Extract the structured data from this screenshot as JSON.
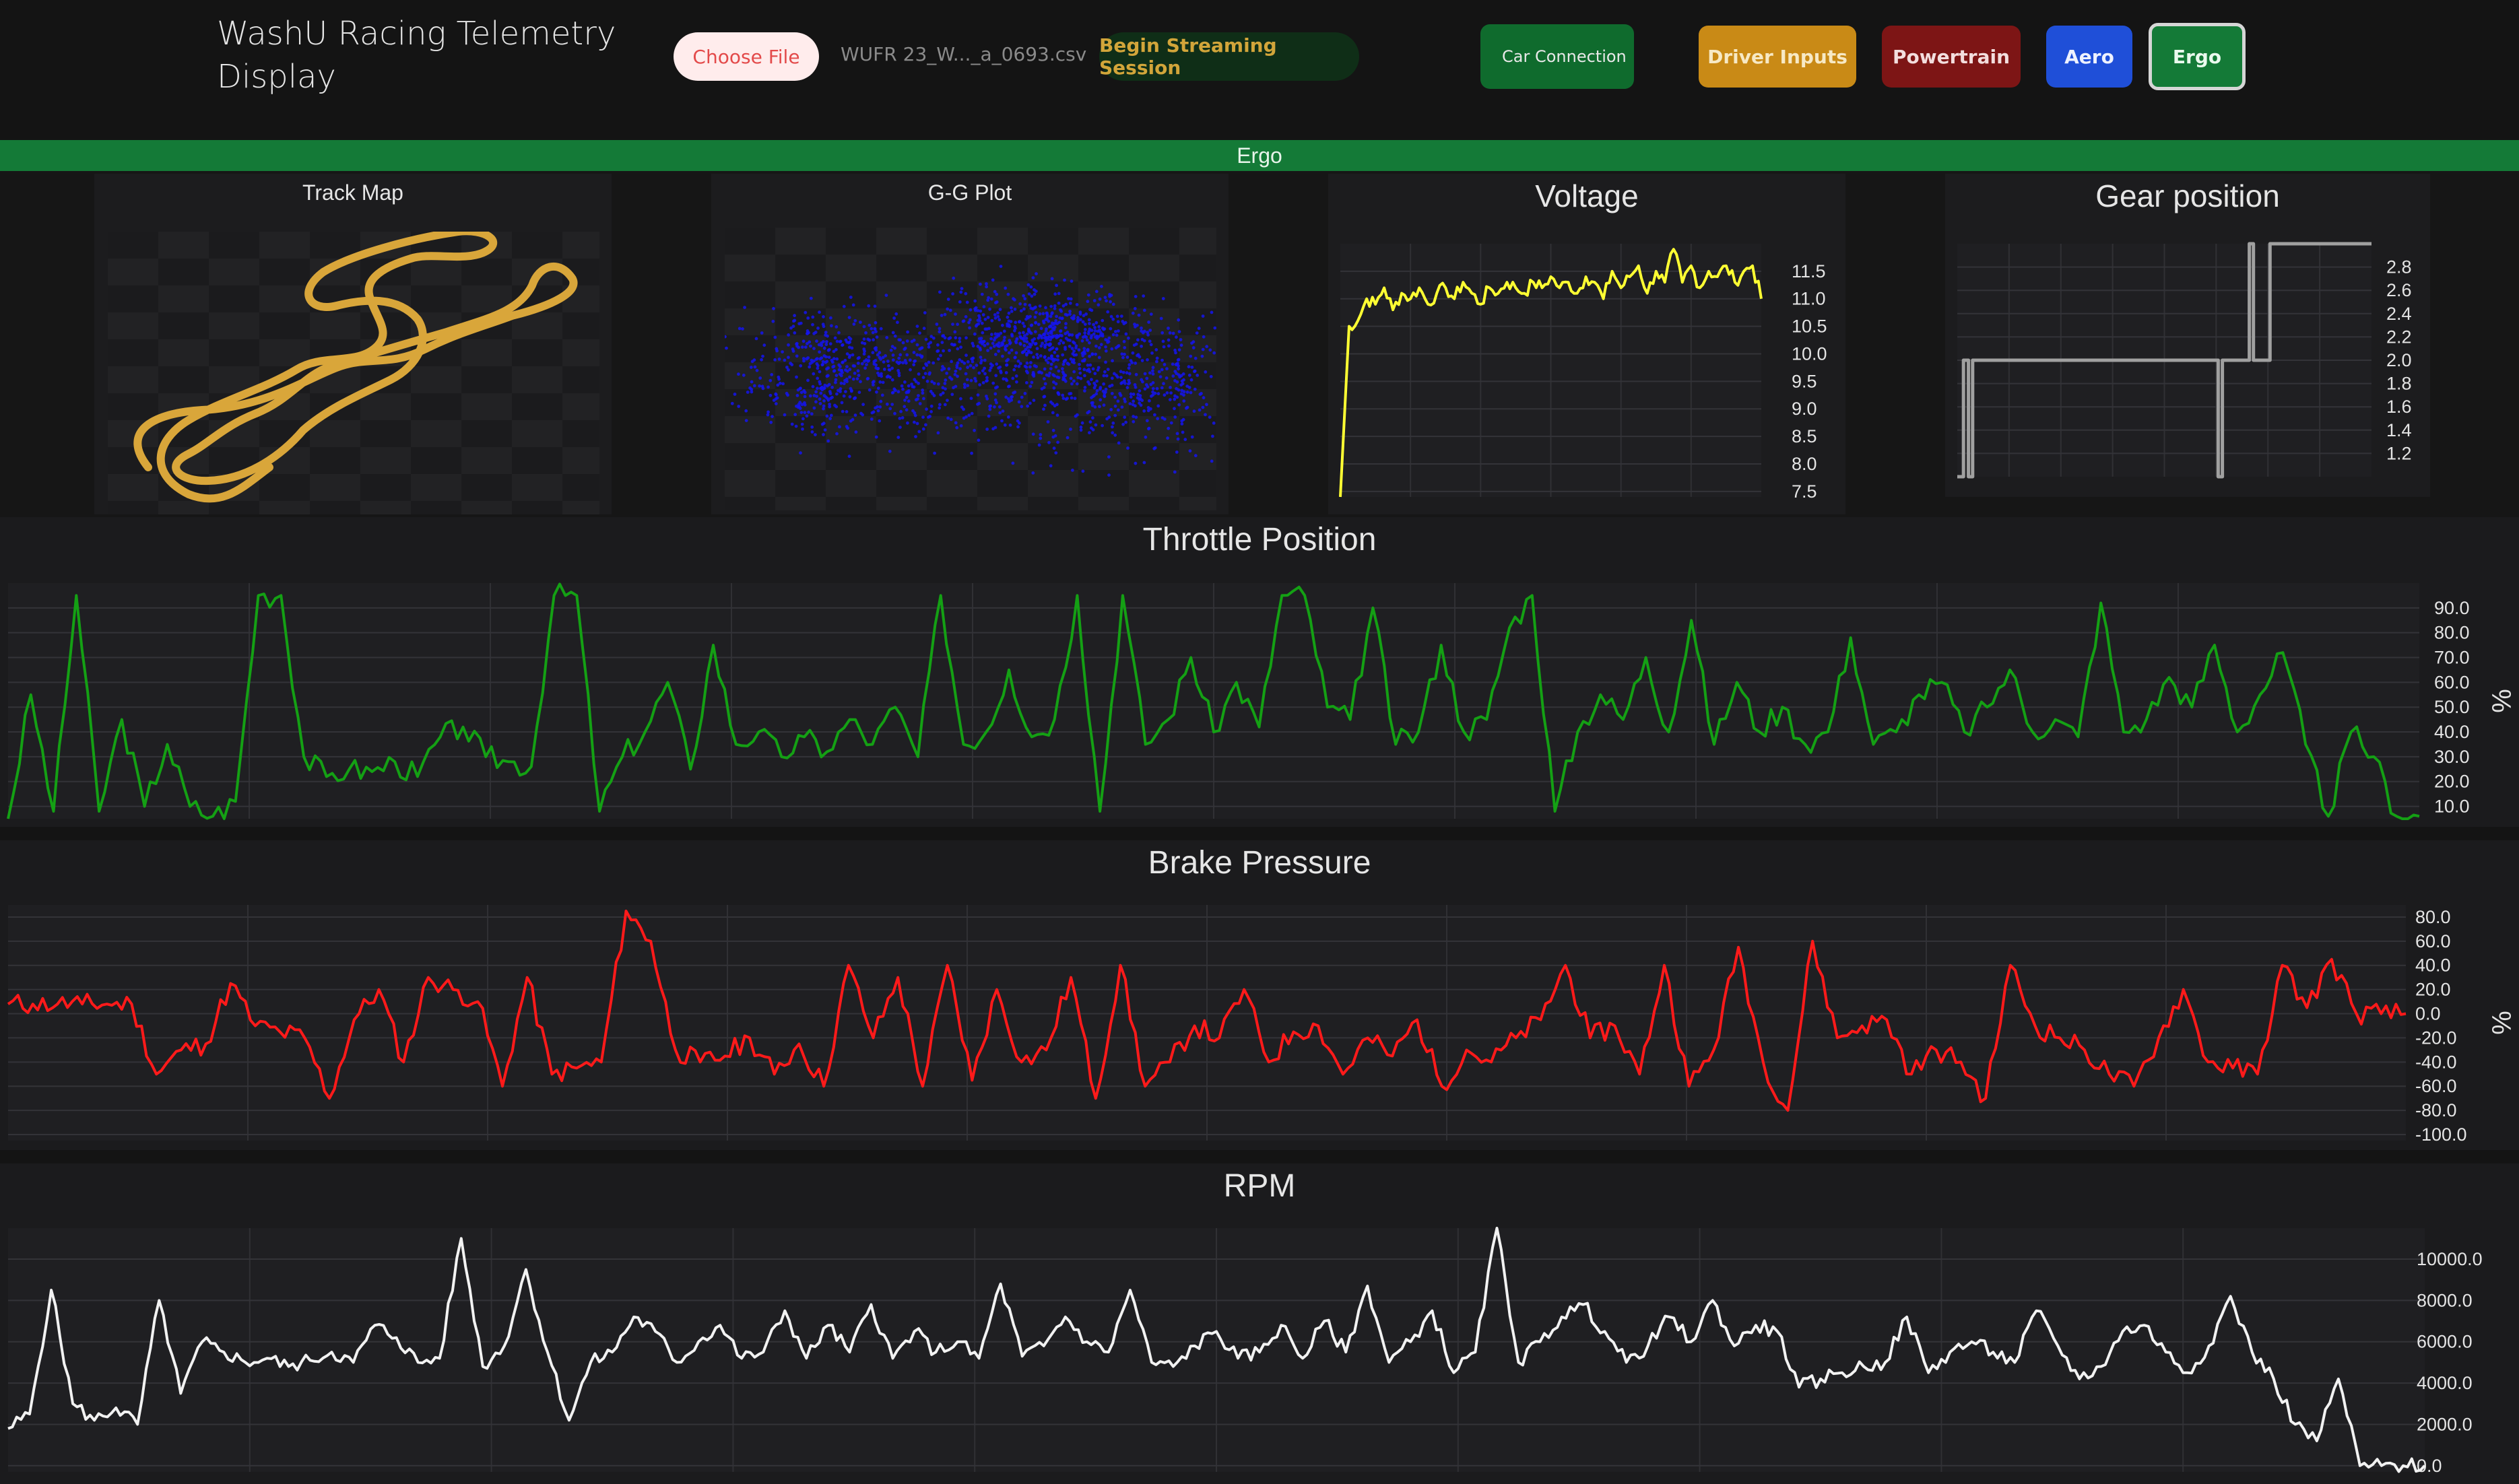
{
  "app": {
    "title": "WashU Racing Telemetry Display"
  },
  "toolbar": {
    "choose_file": "Choose File",
    "file_name": "WUFR 23_W..._a_0693.csv",
    "begin_stream": "Begin Streaming Session",
    "car_connection": "Car Connection"
  },
  "tabs": [
    {
      "label": "Driver Inputs",
      "color": "#c98a16"
    },
    {
      "label": "Powertrain",
      "color": "#7d1515"
    },
    {
      "label": "Aero",
      "color": "#1f4fd8"
    },
    {
      "label": "Ergo",
      "color": "#147a37",
      "selected": true
    }
  ],
  "section_banner": "Ergo",
  "panels": {
    "track_map": {
      "title": "Track Map"
    },
    "gg_plot": {
      "title": "G-G Plot"
    },
    "voltage": {
      "title": "Voltage"
    },
    "gear": {
      "title": "Gear position"
    },
    "throttle": {
      "title": "Throttle Position"
    },
    "brake": {
      "title": "Brake Pressure"
    },
    "rpm": {
      "title": "RPM"
    }
  },
  "chart_data": [
    {
      "name": "voltage",
      "type": "line",
      "title": "Voltage",
      "color": "#ffff33",
      "ylim": [
        7.4,
        12.0
      ],
      "yticks": [
        "11.5",
        "11.0",
        "10.5",
        "10.0",
        "9.5",
        "9.0",
        "8.5",
        "8.0",
        "7.5"
      ],
      "values": [
        7.4,
        10.5,
        10.6,
        11.0,
        10.9,
        11.2,
        10.8,
        11.1,
        11.0,
        11.2,
        10.9,
        11.1,
        11.2,
        11.0,
        11.3,
        11.1,
        10.9,
        11.2,
        11.1,
        11.3,
        11.2,
        11.1,
        11.3,
        11.2,
        11.4,
        11.2,
        11.3,
        11.1,
        11.4,
        11.3,
        11.0,
        11.5,
        11.2,
        11.4,
        11.6,
        11.1,
        11.5,
        11.3,
        11.9,
        11.3,
        11.6,
        11.2,
        11.5,
        11.4,
        11.6,
        11.3,
        11.5,
        11.6,
        11.0
      ]
    },
    {
      "name": "gear",
      "type": "line",
      "title": "Gear position",
      "color": "#a0a0a0",
      "ylim": [
        1.0,
        3.0
      ],
      "yticks": [
        "2.8",
        "2.6",
        "2.4",
        "2.2",
        "2.0",
        "1.8",
        "1.6",
        "1.4",
        "1.2"
      ],
      "points": [
        [
          0,
          1.0
        ],
        [
          0.015,
          1.0
        ],
        [
          0.015,
          2.0
        ],
        [
          0.027,
          2.0
        ],
        [
          0.027,
          1.0
        ],
        [
          0.037,
          1.0
        ],
        [
          0.037,
          2.0
        ],
        [
          0.63,
          2.0
        ],
        [
          0.63,
          1.0
        ],
        [
          0.64,
          1.0
        ],
        [
          0.64,
          2.0
        ],
        [
          0.705,
          2.0
        ],
        [
          0.705,
          3.0
        ],
        [
          0.715,
          3.0
        ],
        [
          0.715,
          2.0
        ],
        [
          0.755,
          2.0
        ],
        [
          0.755,
          3.0
        ],
        [
          1.0,
          3.0
        ]
      ]
    },
    {
      "name": "throttle",
      "type": "line",
      "title": "Throttle Position",
      "unit": "%",
      "color": "#14a014",
      "ylim": [
        5,
        100
      ],
      "yticks": [
        "90.0",
        "80.0",
        "70.0",
        "60.0",
        "50.0",
        "40.0",
        "30.0",
        "20.0",
        "10.0"
      ],
      "values": [
        5,
        55,
        8,
        95,
        8,
        45,
        10,
        35,
        10,
        6,
        12,
        95,
        95,
        30,
        22,
        25,
        24,
        28,
        22,
        38,
        42,
        30,
        28,
        26,
        95,
        95,
        8,
        30,
        40,
        60,
        25,
        75,
        35,
        40,
        30,
        38,
        32,
        45,
        35,
        50,
        30,
        95,
        35,
        40,
        65,
        38,
        45,
        95,
        8,
        95,
        35,
        45,
        70,
        40,
        60,
        42,
        95,
        95,
        50,
        45,
        90,
        35,
        40,
        75,
        40,
        45,
        82,
        95,
        8,
        40,
        55,
        45,
        70,
        40,
        85,
        35,
        60,
        40,
        50,
        35,
        40,
        78,
        35,
        40,
        55,
        60,
        40,
        50,
        65,
        40,
        45,
        38,
        92,
        40,
        45,
        62,
        50,
        75,
        40,
        55,
        72,
        35,
        6,
        40,
        30,
        6,
        6
      ]
    },
    {
      "name": "brake",
      "type": "line",
      "title": "Brake Pressure",
      "unit": "%",
      "color": "#ff1a1a",
      "ylim": [
        -105,
        90
      ],
      "yticks": [
        "80.0",
        "60.0",
        "40.0",
        "20.0",
        "0.0",
        "-20.0",
        "-40.0",
        "-60.0",
        "-80.0",
        "-100.0"
      ],
      "values": [
        8,
        8,
        8,
        8,
        8,
        8,
        -50,
        -30,
        -25,
        25,
        -10,
        -15,
        -20,
        -70,
        -5,
        20,
        -40,
        30,
        20,
        10,
        -60,
        30,
        -50,
        -45,
        -40,
        85,
        60,
        -30,
        -40,
        -35,
        -20,
        -50,
        -25,
        -60,
        40,
        -20,
        30,
        -60,
        40,
        -55,
        20,
        -40,
        -30,
        30,
        -70,
        40,
        -60,
        -40,
        -10,
        -20,
        20,
        -40,
        -15,
        -10,
        -50,
        -20,
        -35,
        -5,
        -60,
        -30,
        -40,
        -20,
        -5,
        40,
        -20,
        -10,
        -50,
        40,
        -60,
        -30,
        55,
        -40,
        -80,
        60,
        -20,
        -10,
        -5,
        -50,
        -30,
        -40,
        -70,
        40,
        -10,
        -20,
        -30,
        -50,
        -60,
        -20,
        20,
        -40,
        -45,
        -50,
        40,
        5,
        45,
        0,
        0,
        0
      ]
    },
    {
      "name": "rpm",
      "type": "line",
      "title": "RPM",
      "color": "#f2f2f2",
      "ylim": [
        -300,
        11500
      ],
      "yticks": [
        "10000.0",
        "8000.0",
        "6000.0",
        "4000.0",
        "2000.0",
        "0.0"
      ],
      "values": [
        1800,
        2500,
        8500,
        3000,
        2200,
        2800,
        2000,
        8000,
        3500,
        6000,
        5500,
        5000,
        5200,
        4800,
        5100,
        5500,
        5000,
        6800,
        6200,
        5000,
        5200,
        11000,
        4800,
        5800,
        9500,
        5500,
        2200,
        5000,
        5500,
        7200,
        6500,
        5000,
        6000,
        6800,
        5200,
        5500,
        7500,
        5200,
        6800,
        5500,
        7800,
        5200,
        6500,
        5500,
        6000,
        5200,
        8800,
        5300,
        5800,
        7200,
        6000,
        5500,
        8500,
        5000,
        4800,
        5800,
        6500,
        5200,
        5500,
        6800,
        5200,
        7000,
        5500,
        8700,
        5000,
        6000,
        7500,
        4500,
        5500,
        11500,
        5000,
        6000,
        7200,
        7800,
        6500,
        5000,
        5800,
        7200,
        6000,
        8000,
        5800,
        6800,
        6500,
        3800,
        4200,
        4500,
        4800,
        5000,
        7200,
        4500,
        5500,
        6000,
        5500,
        5000,
        7500,
        5800,
        4200,
        4800,
        6500,
        6800,
        5500,
        4500,
        5800,
        8200,
        5500,
        4200,
        2000,
        1200,
        4200,
        0,
        0,
        0,
        0
      ]
    }
  ]
}
